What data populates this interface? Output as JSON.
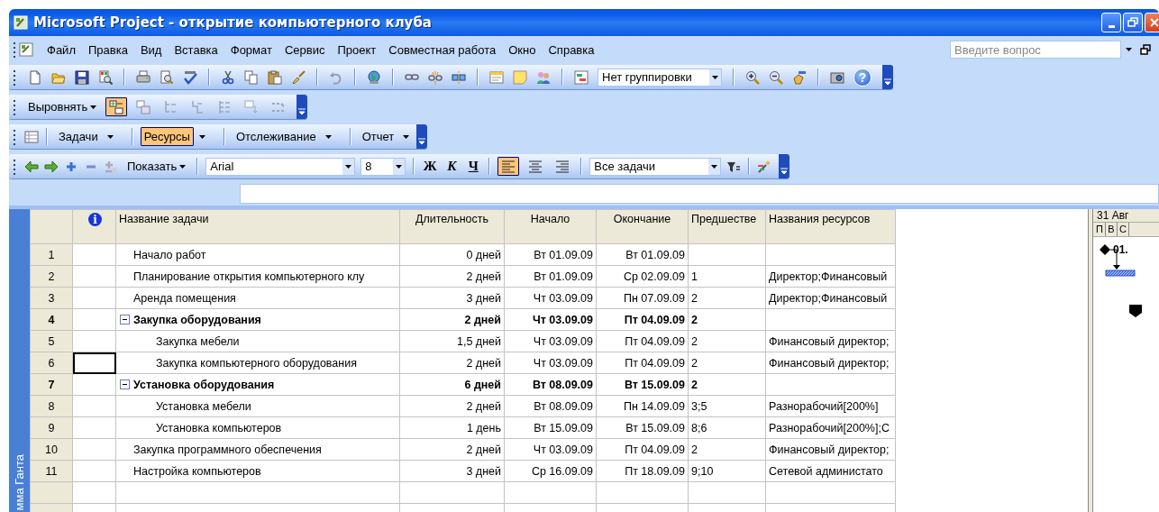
{
  "window": {
    "title": "Microsoft Project - открытие компьютерного клуба"
  },
  "menu": {
    "items": [
      "Файл",
      "Правка",
      "Вид",
      "Вставка",
      "Формат",
      "Сервис",
      "Проект",
      "Совместная работа",
      "Окно",
      "Справка"
    ],
    "help_search": {
      "placeholder": "Введите вопрос"
    }
  },
  "standard_toolbar": {
    "grouping": "Нет группировки",
    "help_symbol": "?"
  },
  "align_toolbar": {
    "label": "Выровнять",
    "tools": [
      {
        "pressed": true
      },
      {
        "pressed": false
      },
      {
        "pressed": false
      },
      {
        "pressed": false
      },
      {
        "pressed": false
      },
      {
        "pressed": false
      },
      {
        "pressed": false
      }
    ]
  },
  "views_toolbar": {
    "items": [
      {
        "label": "Задачи",
        "selected": false
      },
      {
        "label": "Ресурсы",
        "selected": true
      },
      {
        "label": "Отслеживание",
        "selected": false
      },
      {
        "label": "Отчет",
        "selected": false
      }
    ]
  },
  "format_toolbar": {
    "show": "Показать",
    "font": "Arial",
    "size": "8",
    "bold": "Ж",
    "italic": "К",
    "underline": "Ч",
    "alignment_buttons": [
      {
        "selected": true
      },
      {
        "selected": false
      },
      {
        "selected": false
      }
    ],
    "filter": "Все задачи"
  },
  "view_bar": {
    "label": "мма Ганта"
  },
  "table": {
    "indicator_symbol": "i",
    "columns": [
      "Название задачи",
      "Длительность",
      "Начало",
      "Окончание",
      "Предшестве",
      "Названия ресурсов"
    ],
    "rows": [
      {
        "id": "1",
        "kind": "task",
        "name": "Начало работ",
        "duration": "0 дней",
        "start": "Вт 01.09.09",
        "finish": "Вт 01.09.09",
        "active": false
      },
      {
        "id": "2",
        "kind": "task",
        "name": "Планирование открытия компьютерного клу",
        "duration": "2 дней",
        "start": "Вт 01.09.09",
        "finish": "Ср 02.09.09",
        "predecessors": "1",
        "resources": "Директор;Финансовый",
        "active": false
      },
      {
        "id": "3",
        "kind": "task",
        "name": "Аренда помещения",
        "duration": "3 дней",
        "start": "Чт 03.09.09",
        "finish": "Пн 07.09.09",
        "predecessors": "2",
        "resources": "Директор;Финансовый",
        "active": false
      },
      {
        "id": "4",
        "kind": "summary",
        "expanded": true,
        "name": "Закупка оборудования",
        "duration": "2 дней",
        "start": "Чт 03.09.09",
        "finish": "Пт 04.09.09",
        "predecessors": "2",
        "active": false,
        "children": [
          {
            "id": "5",
            "kind": "task",
            "name": "Закупка мебели",
            "duration": "1,5 дней",
            "start": "Чт 03.09.09",
            "finish": "Пт 04.09.09",
            "predecessors": "2",
            "resources": "Финансовый директор;",
            "active": false
          },
          {
            "id": "6",
            "kind": "task",
            "name": "Закупка компьютерного оборудования",
            "duration": "2 дней",
            "start": "Чт 03.09.09",
            "finish": "Пт 04.09.09",
            "predecessors": "2",
            "resources": "Финансовый директор;",
            "active": true
          }
        ]
      },
      {
        "id": "7",
        "kind": "summary",
        "expanded": true,
        "name": "Установка оборудования",
        "duration": "6 дней",
        "start": "Вт 08.09.09",
        "finish": "Вт 15.09.09",
        "predecessors": "2",
        "active": false,
        "children": [
          {
            "id": "8",
            "kind": "task",
            "name": "Установка мебели",
            "duration": "2 дней",
            "start": "Вт 08.09.09",
            "finish": "Пн 14.09.09",
            "predecessors": "3;5",
            "resources": "Разнорабочий[200%]",
            "active": false
          },
          {
            "id": "9",
            "kind": "task",
            "name": "Установка компьютеров",
            "duration": "1 день",
            "start": "Вт 15.09.09",
            "finish": "Вт 15.09.09",
            "predecessors": "8;6",
            "resources": "Разнорабочий[200%];С",
            "active": false
          }
        ]
      },
      {
        "id": "10",
        "kind": "task",
        "name": "Закупка программного обеспечения",
        "duration": "2 дней",
        "start": "Чт 03.09.09",
        "finish": "Пт 04.09.09",
        "predecessors": "2",
        "resources": "Финансовый директор;",
        "active": false
      },
      {
        "id": "11",
        "kind": "task",
        "name": "Настройка компьютеров",
        "duration": "3 дней",
        "start": "Ср 16.09.09",
        "finish": "Пт 18.09.09",
        "predecessors": "9;10",
        "resources": "Сетевой администато",
        "active": false
      }
    ]
  },
  "gantt": {
    "week": "31 Авг",
    "days": [
      "П",
      "В",
      "С"
    ],
    "milestone_label": "01."
  }
}
